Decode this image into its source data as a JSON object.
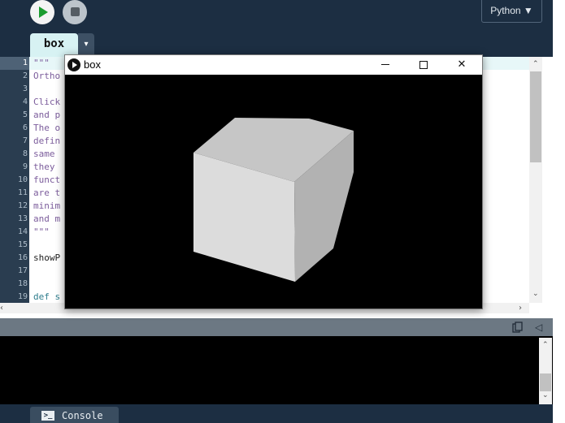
{
  "toolbar": {
    "run_icon": "play-icon",
    "stop_icon": "stop-icon",
    "mode_label": "Python ▼"
  },
  "tab": {
    "name": "box",
    "menu_glyph": "▾"
  },
  "editor": {
    "line_numbers": [
      "1",
      "2",
      "3",
      "4",
      "5",
      "6",
      "7",
      "8",
      "9",
      "10",
      "11",
      "12",
      "13",
      "14",
      "15",
      "16",
      "17",
      "18",
      "19"
    ],
    "lines": [
      "\"\"\"",
      "Ortho",
      "",
      "Click",
      "and p",
      "The o",
      "defin",
      "same ",
      "they ",
      "funct",
      "are t",
      "minim",
      "and m",
      "\"\"\"",
      "",
      "showP",
      "",
      "",
      "def s"
    ]
  },
  "scroll": {
    "up": "⌃",
    "down": "⌄",
    "left": "‹",
    "right": "›"
  },
  "console": {
    "collapse_glyph": "◁",
    "tab_label": "Console",
    "tab_glyph": ">_"
  },
  "sketch_window": {
    "title": "box",
    "minimize_icon": "minimize-icon",
    "maximize_icon": "maximize-icon",
    "close_label": "✕",
    "colors": {
      "background": "#000000",
      "face_top": "#c6c6c6",
      "face_front": "#dcdcdc",
      "face_side": "#b2b2b2"
    }
  }
}
